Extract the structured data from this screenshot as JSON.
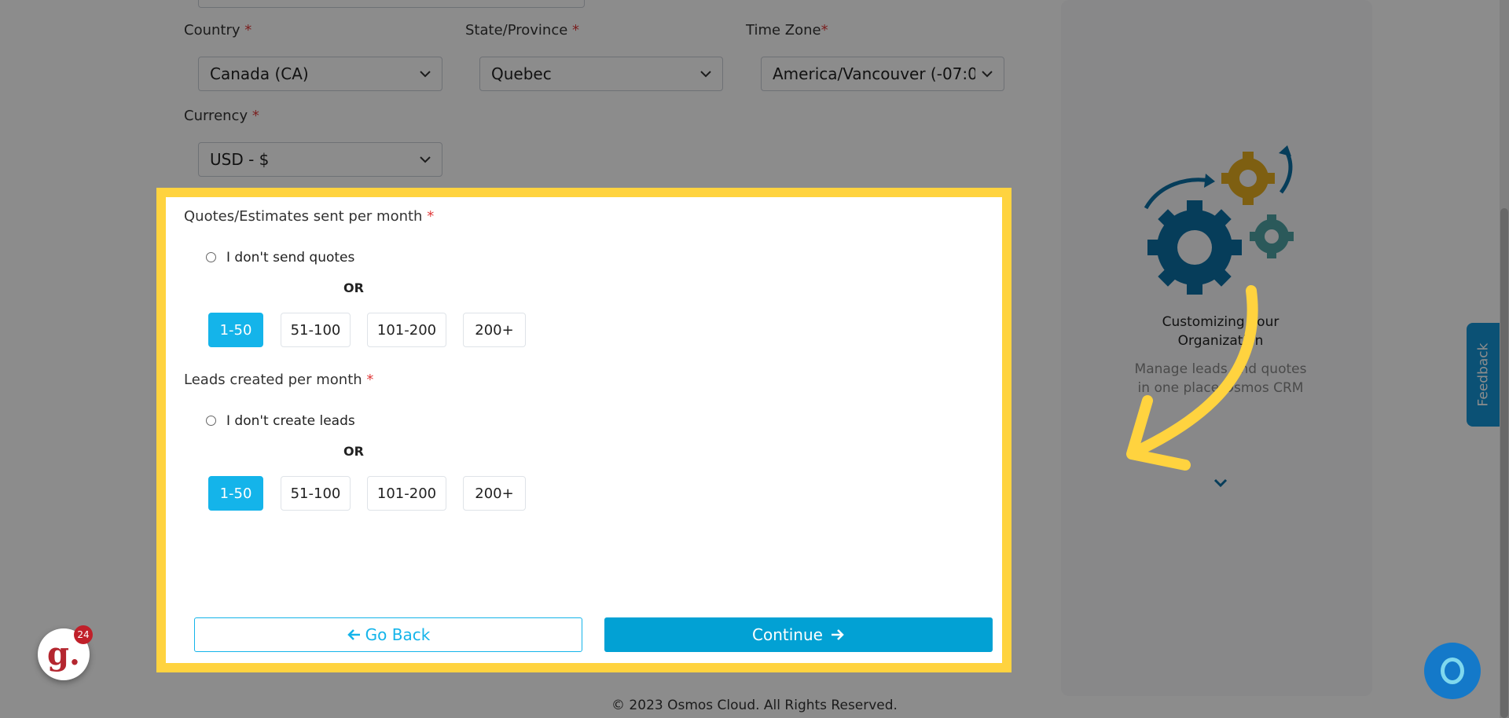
{
  "top_form": {
    "country": {
      "label": "Country",
      "required": "*",
      "value": "Canada (CA)"
    },
    "state": {
      "label": "State/Province",
      "required": "*",
      "value": "Quebec"
    },
    "timezone": {
      "label": "Time Zone",
      "required": "*",
      "value": "America/Vancouver (-07:0"
    },
    "currency": {
      "label": "Currency",
      "required": "*",
      "value": "USD - $"
    }
  },
  "quotes": {
    "label": "Quotes/Estimates sent per month",
    "required": "*",
    "none_option": "I don't send quotes",
    "or": "OR",
    "options": [
      "1-50",
      "51-100",
      "101-200",
      "200+"
    ],
    "selected": "1-50"
  },
  "leads": {
    "label": "Leads created per month",
    "required": "*",
    "none_option": "I don't create leads",
    "or": "OR",
    "options": [
      "1-50",
      "51-100",
      "101-200",
      "200+"
    ],
    "selected": "1-50"
  },
  "actions": {
    "back": "Go Back",
    "continue": "Continue"
  },
  "side_panel": {
    "title_line1": "Customizing your",
    "title_line2": "Organization",
    "desc_line1": "Manage leads and quotes",
    "desc_line2": "in one place Osmos CRM"
  },
  "feedback_tab": "Feedback",
  "footer": "© 2023 Osmos Cloud. All Rights Reserved.",
  "notif_badge": "24",
  "colors": {
    "accent": "#14b4ea",
    "primary": "#02a1d4",
    "highlight": "#ffd33f",
    "arrow": "#ffd33f"
  }
}
